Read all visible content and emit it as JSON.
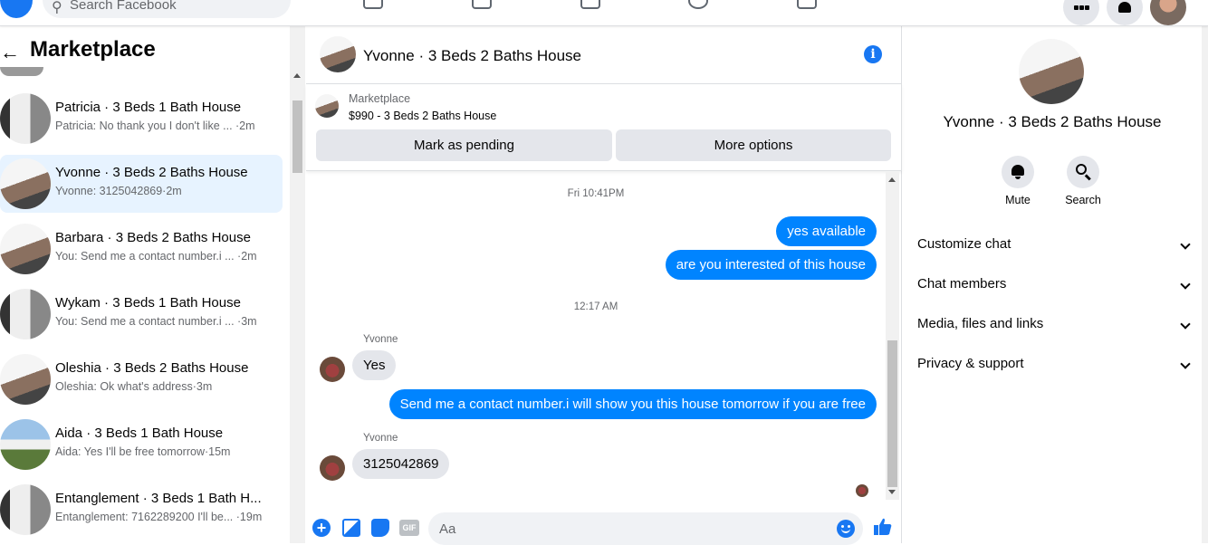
{
  "topbar": {
    "search_placeholder": "Search Facebook"
  },
  "left": {
    "title": "Marketplace",
    "conversations": [
      {
        "name": "Patricia · 3 Beds 1 Bath House",
        "preview": "Patricia: No thank you I don't like ... ·2m"
      },
      {
        "name": "Yvonne · 3 Beds 2 Baths House",
        "preview": "Yvonne: 3125042869·2m"
      },
      {
        "name": "Barbara · 3 Beds 2 Baths House",
        "preview": "You: Send me a contact number.i ... ·2m"
      },
      {
        "name": "Wykam · 3 Beds 1 Bath House",
        "preview": "You: Send me a contact number.i ... ·3m"
      },
      {
        "name": "Oleshia · 3 Beds 2 Baths House",
        "preview": "Oleshia: Ok what's address·3m"
      },
      {
        "name": "Aida · 3 Beds 1 Bath House",
        "preview": "Aida: Yes I'll be free tomorrow·15m"
      },
      {
        "name": "Entanglement · 3 Beds 1 Bath H...",
        "preview": "Entanglement: 7162289200 I'll be... ·19m"
      }
    ]
  },
  "chat": {
    "title": "Yvonne · 3 Beds 2 Baths House",
    "listing_label": "Marketplace",
    "listing_price": "$990 - 3 Beds 2 Baths House",
    "btn_pending": "Mark as pending",
    "btn_more": "More options",
    "ts1": "Fri 10:41PM",
    "out1": "yes available",
    "out2": "are you interested of this house",
    "ts2": "12:17 AM",
    "sender": "Yvonne",
    "in1": "Yes",
    "out3": "Send me a contact number.i will show you this house tomorrow if you are free",
    "in2": "3125042869",
    "composer_placeholder": "Aa",
    "gif_label": "GIF"
  },
  "right": {
    "title": "Yvonne · 3 Beds 2 Baths House",
    "mute": "Mute",
    "search": "Search",
    "items": [
      "Customize chat",
      "Chat members",
      "Media, files and links",
      "Privacy & support"
    ]
  }
}
